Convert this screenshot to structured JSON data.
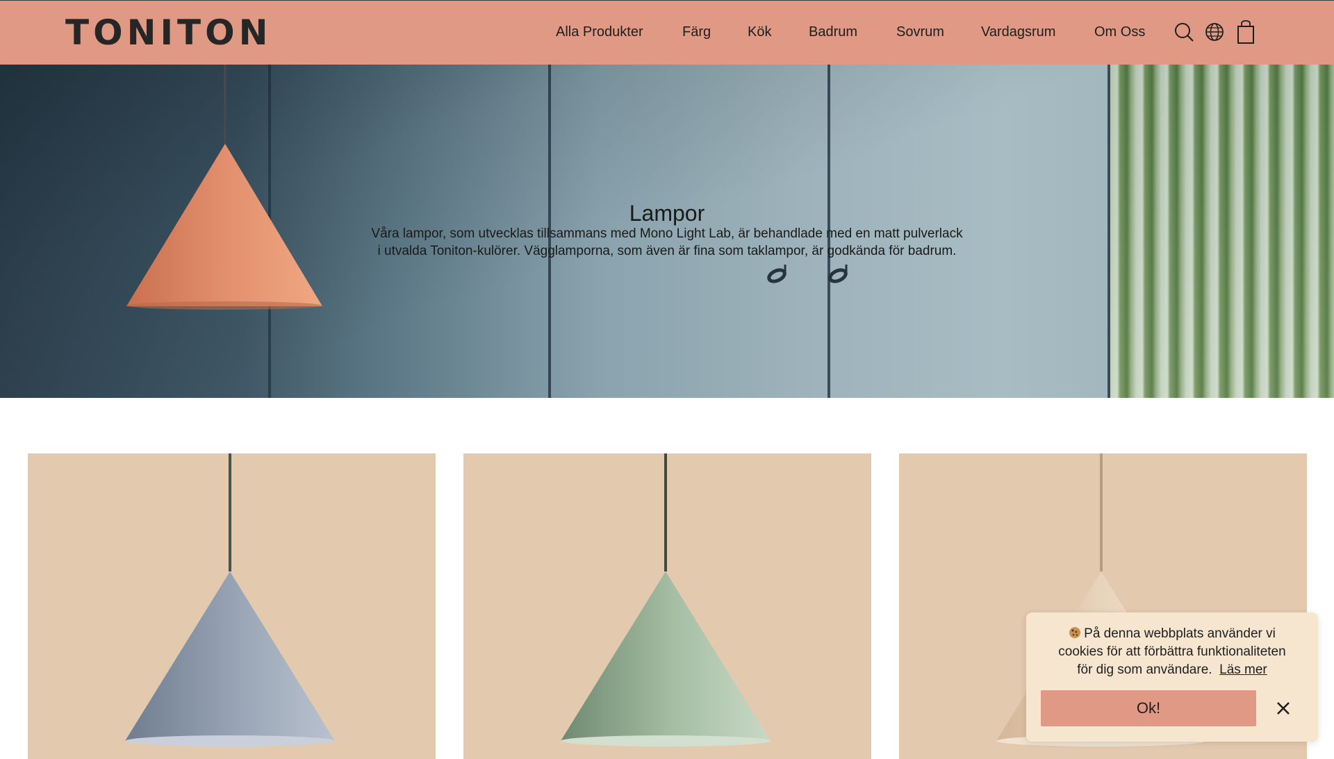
{
  "brand": {
    "logo": "TONITON"
  },
  "nav": {
    "items": [
      {
        "label": "Alla Produkter"
      },
      {
        "label": "Färg"
      },
      {
        "label": "Kök"
      },
      {
        "label": "Badrum"
      },
      {
        "label": "Sovrum"
      },
      {
        "label": "Vardagsrum"
      },
      {
        "label": "Om Oss"
      }
    ],
    "icons": [
      "search-icon",
      "globe-icon",
      "shopping-bag-icon"
    ]
  },
  "hero": {
    "title": "Lampor",
    "description_line1": "Våra lampor, som utvecklas tillsammans med Mono Light Lab, är behandlade med en matt pulverlack",
    "description_line2": "i utvalda Toniton-kulörer. Vägglamporna, som även är fina som taklampor, är godkända för badrum."
  },
  "products": [
    {
      "lamp_color": "#9aa6b6"
    },
    {
      "lamp_color": "#a6bfa5"
    },
    {
      "lamp_color": "#ead6bf"
    }
  ],
  "cookie": {
    "icon": "cookie-icon",
    "text_line1": "På denna webbplats använder vi",
    "text_line2": "cookies för att förbättra funktionaliteten",
    "text_line3": "för dig som användare.",
    "link": "Läs mer",
    "ok_label": "Ok!"
  },
  "colors": {
    "header_bg": "#df9984",
    "card_bg": "#e3c9ae",
    "cookie_bg": "#f6e5cf"
  }
}
